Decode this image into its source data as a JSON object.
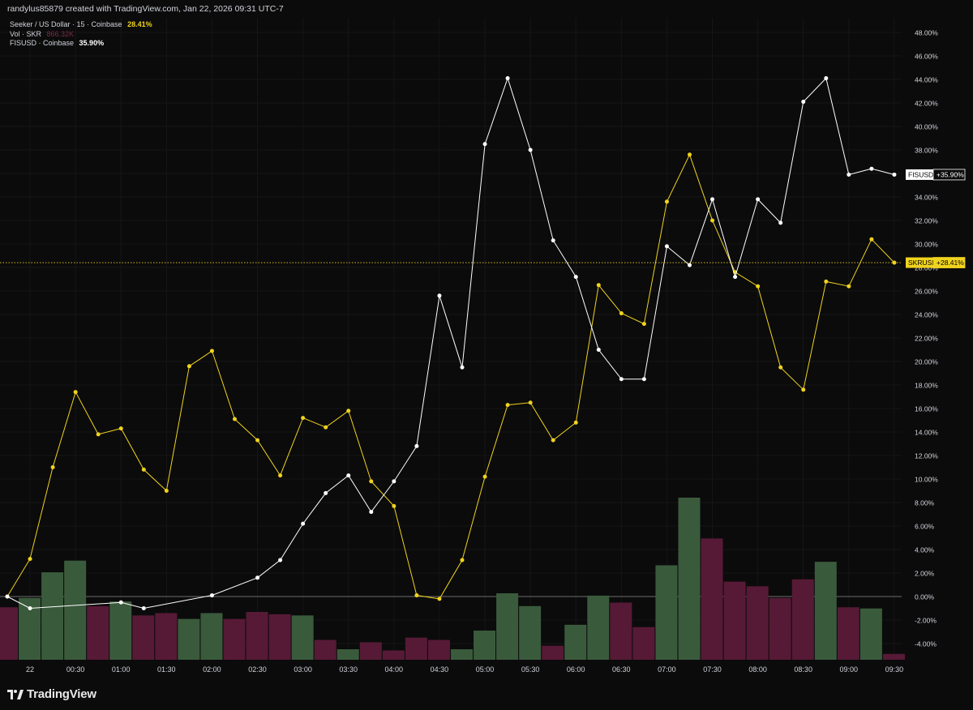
{
  "header": {
    "attribution": "randylus85879 created with TradingView.com, Jan 22, 2026 09:31 UTC-7"
  },
  "legend": {
    "main_label": "Seeker / US Dollar · 15 · Coinbase",
    "main_value": "28.41%",
    "vol_label": "Vol · SKR",
    "vol_value": "866.32K",
    "compare_label": "FISUSD · Coinbase",
    "compare_value": "35.90%"
  },
  "brand": {
    "logo_text": "TradingView"
  },
  "colors": {
    "background": "#0b0b0b",
    "skr_line": "#f0d31e",
    "fis_line": "#ffffff",
    "vol_up": "#3a5a3c",
    "vol_down": "#561a36",
    "axis_text": "#d1d4dc"
  },
  "chart_data": {
    "type": "line",
    "x_labels": [
      "22",
      "00:30",
      "01:00",
      "01:30",
      "02:00",
      "02:30",
      "03:00",
      "03:30",
      "04:00",
      "04:30",
      "05:00",
      "05:30",
      "06:00",
      "06:30",
      "07:00",
      "07:30",
      "08:00",
      "08:30",
      "09:00",
      "09:30"
    ],
    "y_axis_unit": "%",
    "ylim": [
      -5.5,
      49
    ],
    "y_ticks": [
      "48.00%",
      "46.00%",
      "44.00%",
      "42.00%",
      "40.00%",
      "38.00%",
      "36.00%",
      "34.00%",
      "32.00%",
      "30.00%",
      "28.00%",
      "26.00%",
      "24.00%",
      "22.00%",
      "20.00%",
      "18.00%",
      "16.00%",
      "14.00%",
      "12.00%",
      "10.00%",
      "8.00%",
      "6.00%",
      "4.00%",
      "2.00%",
      "0.00%",
      "-2.00%",
      "-4.00%"
    ],
    "series": [
      {
        "name": "SKRUSD",
        "color": "#f0d31e",
        "last_label": "+28.41%",
        "values": [
          0.0,
          3.2,
          11.0,
          17.4,
          13.8,
          14.3,
          10.8,
          9.0,
          19.6,
          20.9,
          15.1,
          13.3,
          10.3,
          15.2,
          14.4,
          15.8,
          9.8,
          7.7,
          0.1,
          -0.2,
          3.1,
          10.2,
          16.3,
          16.5,
          13.3,
          14.8,
          26.5,
          24.1,
          23.2,
          33.6,
          37.6,
          32.0,
          27.6,
          26.4,
          19.5,
          17.6,
          26.8,
          26.4,
          30.4,
          28.41
        ]
      },
      {
        "name": "FISUSD",
        "color": "#ffffff",
        "last_label": "+35.90%",
        "values": [
          0.0,
          -1.0,
          null,
          null,
          null,
          -0.5,
          -1.0,
          null,
          null,
          0.1,
          null,
          1.6,
          3.1,
          6.2,
          8.8,
          10.3,
          7.2,
          9.8,
          12.8,
          25.6,
          19.5,
          38.5,
          44.1,
          38.0,
          30.3,
          27.2,
          21.0,
          18.5,
          18.5,
          29.8,
          28.2,
          33.8,
          27.2,
          33.8,
          31.8,
          42.1,
          44.1,
          35.9,
          36.4,
          35.9
        ]
      }
    ],
    "volume": {
      "name": "Vol · SKR",
      "direction": [
        "down",
        "up",
        "up",
        "up",
        "down",
        "up",
        "down",
        "down",
        "up",
        "up",
        "down",
        "down",
        "down",
        "up",
        "down",
        "up",
        "down",
        "down",
        "down",
        "down",
        "up",
        "up",
        "up",
        "up",
        "down",
        "up",
        "up",
        "down",
        "down",
        "up",
        "up",
        "down",
        "down",
        "down",
        "down",
        "down",
        "up",
        "down",
        "up",
        "down"
      ],
      "values": [
        450,
        530,
        750,
        850,
        460,
        500,
        380,
        400,
        350,
        400,
        350,
        410,
        390,
        380,
        170,
        90,
        150,
        80,
        190,
        170,
        90,
        250,
        570,
        460,
        120,
        300,
        550,
        490,
        280,
        810,
        1390,
        1040,
        670,
        630,
        530,
        690,
        840,
        450,
        440,
        50
      ]
    }
  }
}
